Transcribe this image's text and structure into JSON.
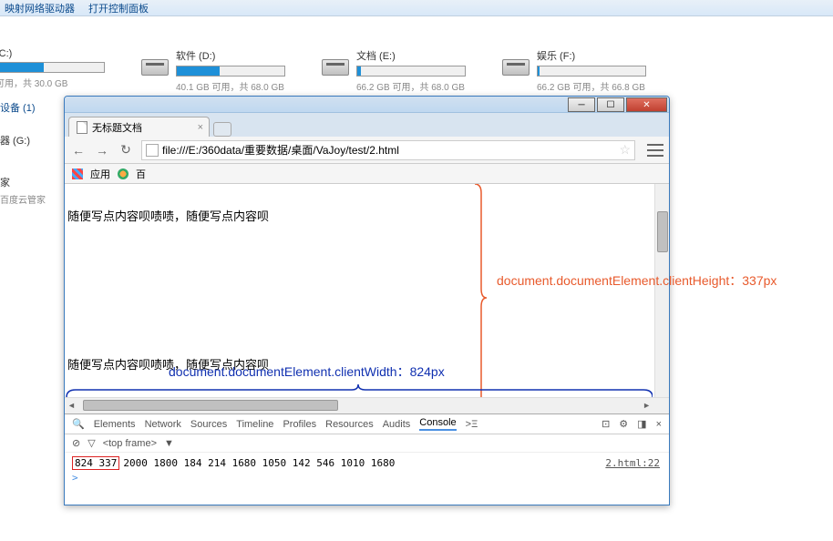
{
  "topbar": {
    "item1": "映射网络驱动器",
    "item2": "打开控制面板"
  },
  "drives": [
    {
      "label": "(C:)",
      "fill": 44,
      "stats": "可用，共 30.0 GB"
    },
    {
      "label": "软件 (D:)",
      "fill": 40,
      "stats": "40.1 GB 可用，共 68.0 GB"
    },
    {
      "label": "文档 (E:)",
      "fill": 3,
      "stats": "66.2 GB 可用，共 68.0 GB"
    },
    {
      "label": "娱乐 (F:)",
      "fill": 2,
      "stats": "66.2 GB 可用，共 66.8 GB"
    }
  ],
  "side": {
    "devices": "设备 (1)",
    "g": "器 (G:)",
    "home": "家",
    "baidu": "百度云管家"
  },
  "browser": {
    "tab_title": "无标题文档",
    "url": "file:///E:/360data/重要数据/桌面/VaJoy/test/2.html",
    "bm_apps": "应用",
    "bm_baidu": "百"
  },
  "content": {
    "line1": "随便写点内容呗啧啧，随便写点内容呗",
    "line2": "随便写点内容呗啧啧，随便写点内容呗"
  },
  "annotations": {
    "height_label": "document.documentElement.clientHeight：337px",
    "width_label": "document.documentElement.clientWidth：824px"
  },
  "devtools": {
    "tabs": [
      "Elements",
      "Network",
      "Sources",
      "Timeline",
      "Profiles",
      "Resources",
      "Audits",
      "Console"
    ],
    "active_tab": "Console",
    "frame": "<top frame>",
    "console_values": "824 337 2000 1800 184 214 1680 1050 142 546 1010 1680",
    "highlighted": "824 337",
    "rest_values": "2000 1800 184 214 1680 1050 142 546 1010 1680",
    "source": "2.html:22",
    "prompt": ">"
  }
}
